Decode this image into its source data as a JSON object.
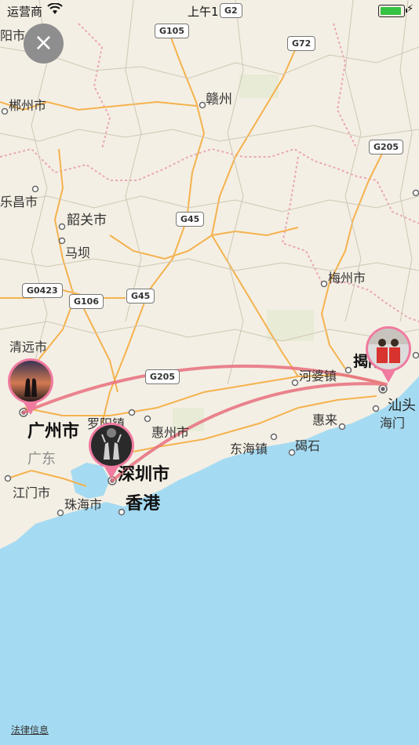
{
  "status_bar": {
    "carrier": "运营商",
    "time": "上午1:27"
  },
  "close_button": {
    "icon": "close-icon",
    "label": "×"
  },
  "map": {
    "cities": {
      "chenzhou": "郴州市",
      "ganzhou": "赣州",
      "shaoguan": "韶关市",
      "mapa": "马坝",
      "meizhou": "梅州市",
      "qingyuan": "清远市",
      "guangzhou": "广州市",
      "luoyang": "罗阳镇",
      "huizhou": "惠州市",
      "guangdong": "广东",
      "shenzhen": "深圳市",
      "hongkong": "香港",
      "jiangmen": "江门市",
      "zhuhai": "珠海市",
      "dongyong": "东海镇",
      "jieshi": "碣石",
      "huilai": "惠来",
      "hepo": "河婆镇",
      "jieyang": "揭阳",
      "shantou": "汕头",
      "haimen": "海门",
      "lechang": "乐昌市",
      "yangshi": "阳市"
    },
    "roads": {
      "g105": "G105",
      "g72": "G72",
      "g205_ne": "G205",
      "g45_mid": "G45",
      "g0423": "G0423",
      "g106": "G106",
      "g45_low": "G45",
      "g205_low": "G205",
      "g2_top": "G2"
    },
    "route_color": "#e8707e",
    "pin_color": "#f07aa0",
    "sea_color": "#a5dbf2",
    "land_color": "#f4efe4"
  },
  "legal_link": "法律信息"
}
